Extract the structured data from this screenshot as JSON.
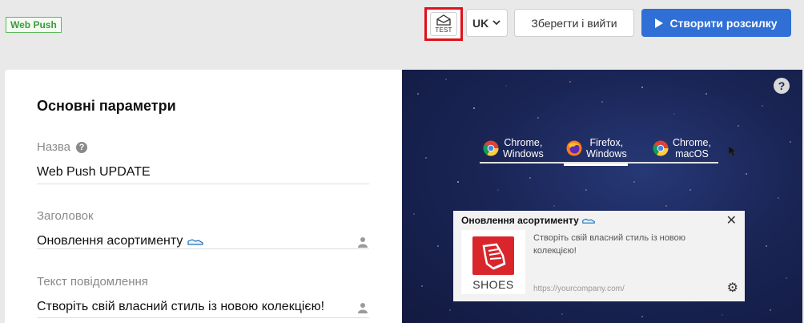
{
  "header": {
    "badge": "Web Push",
    "test_label": "TEST",
    "language": "UK",
    "save_label": "Зберегти і вийти",
    "create_label": "Створити розсилку"
  },
  "form": {
    "section_title": "Основні параметри",
    "name_label": "Назва",
    "name_value": "Web Push UPDATE",
    "heading_label": "Заголовок",
    "heading_value": "Оновлення асортименту",
    "message_label": "Текст повідомлення",
    "message_value": "Створіть свій власний стиль із новою колекцією!"
  },
  "preview": {
    "help": "?",
    "tabs": [
      {
        "line1": "Chrome,",
        "line2": "Windows",
        "icon": "chrome-icon"
      },
      {
        "line1": "Firefox,",
        "line2": "Windows",
        "icon": "firefox-icon"
      },
      {
        "line1": "Chrome,",
        "line2": "macOS",
        "icon": "chrome-icon"
      }
    ],
    "active_tab": 1,
    "notification": {
      "title": "Оновлення асортименту",
      "body": "Створіть свій власний стиль із новою колекцією!",
      "url": "https://yourcompany.com/",
      "image_label": "SHOES"
    }
  },
  "colors": {
    "accent": "#2f6fd6",
    "test_highlight": "#e0101a",
    "badge_green": "#5cb85c",
    "preview_bg": "#1a2556"
  }
}
